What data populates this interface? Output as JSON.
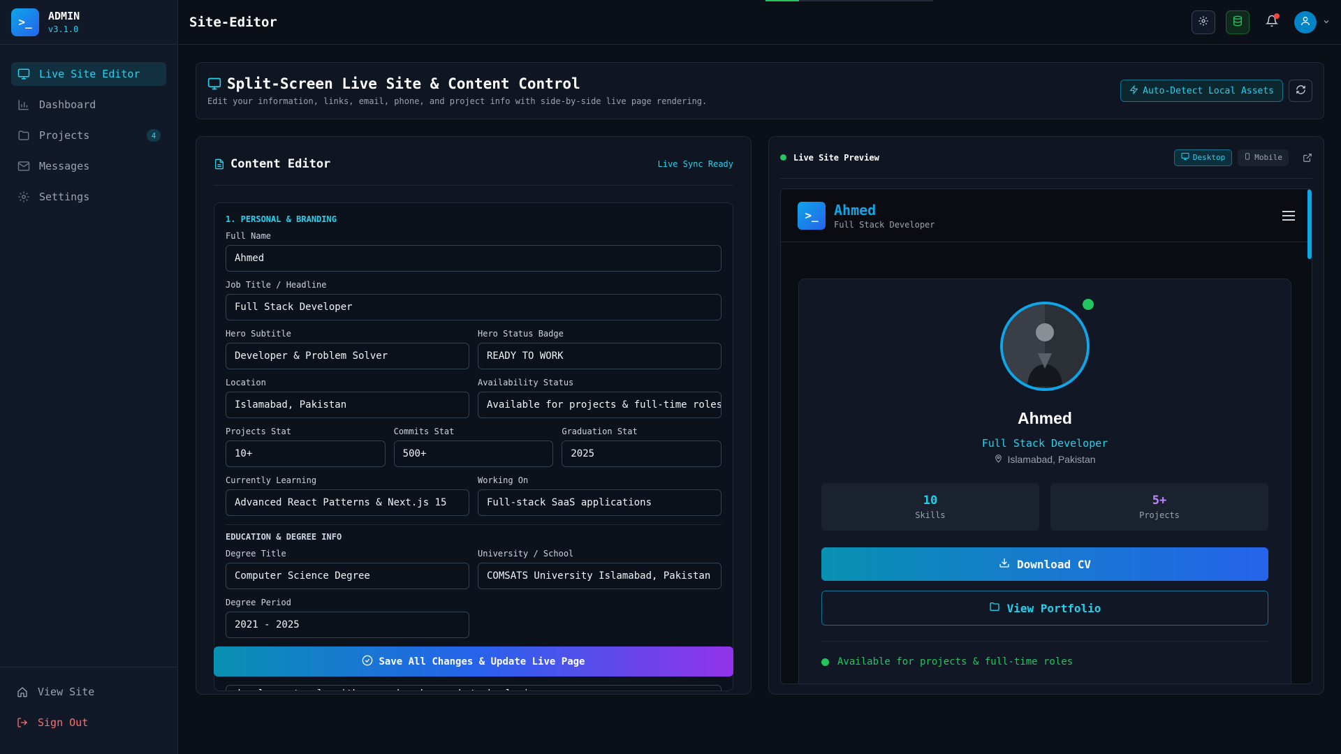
{
  "brand": {
    "name": "ADMIN",
    "version": "v3.1.0",
    "logo_glyph": ">_"
  },
  "sidebar": {
    "items": [
      {
        "label": "Live Site Editor",
        "icon": "monitor-icon",
        "active": true
      },
      {
        "label": "Dashboard",
        "icon": "bar-chart-icon"
      },
      {
        "label": "Projects",
        "icon": "folder-icon",
        "badge": "4"
      },
      {
        "label": "Messages",
        "icon": "mail-icon"
      },
      {
        "label": "Settings",
        "icon": "gear-icon"
      }
    ],
    "footer": [
      {
        "label": "View Site",
        "icon": "home-icon"
      },
      {
        "label": "Sign Out",
        "icon": "logout-icon"
      }
    ]
  },
  "topbar": {
    "title": "Site-Editor",
    "progress": 0.2
  },
  "header": {
    "title": "Split-Screen Live Site & Content Control",
    "subtitle": "Edit your information, links, email, phone, and project info with side-by-side live page rendering.",
    "auto_detect_label": "Auto-Detect Local Assets"
  },
  "editor": {
    "title": "Content Editor",
    "sync_status": "Live Sync Ready",
    "section_title": "1. PERSONAL & BRANDING",
    "fields": {
      "full_name": {
        "label": "Full Name",
        "value": "Ahmed"
      },
      "job_title": {
        "label": "Job Title / Headline",
        "value": "Full Stack Developer"
      },
      "hero_subtitle": {
        "label": "Hero Subtitle",
        "value": "Developer & Problem Solver"
      },
      "hero_status": {
        "label": "Hero Status Badge",
        "value": "READY TO WORK"
      },
      "location": {
        "label": "Location",
        "value": "Islamabad, Pakistan"
      },
      "availability": {
        "label": "Availability Status",
        "value": "Available for projects & full-time roles"
      },
      "projects_stat": {
        "label": "Projects Stat",
        "value": "10+"
      },
      "commits_stat": {
        "label": "Commits Stat",
        "value": "500+"
      },
      "graduation_stat": {
        "label": "Graduation Stat",
        "value": "2025"
      },
      "learning": {
        "label": "Currently Learning",
        "value": "Advanced React Patterns & Next.js 15"
      },
      "working_on": {
        "label": "Working On",
        "value": "Full-stack SaaS applications"
      },
      "degree_title": {
        "label": "Degree Title",
        "value": "Computer Science Degree"
      },
      "university": {
        "label": "University / School",
        "value": "COMSATS University Islamabad, Pakistan"
      },
      "degree_period": {
        "label": "Degree Period",
        "value": "2021 - 2025"
      }
    },
    "education_heading": "EDUCATION & DEGREE INFO",
    "bio_peek": "development, algorithms, and modern web technologies.",
    "save_label": "Save All Changes & Update Live Page"
  },
  "preview": {
    "title": "Live Site Preview",
    "desktop_label": "Desktop",
    "mobile_label": "Mobile",
    "site": {
      "name": "Ahmed",
      "tagline": "Full Stack Developer",
      "hero_name": "Ahmed",
      "hero_role": "Full Stack Developer",
      "hero_location": "Islamabad, Pakistan",
      "stats": [
        {
          "value": "10",
          "label": "Skills",
          "color": "#22d3ee"
        },
        {
          "value": "5+",
          "label": "Projects",
          "color": "#c084fc"
        }
      ],
      "cv_label": "Download CV",
      "portfolio_label": "View Portfolio",
      "availability": "Available for projects & full-time roles"
    }
  }
}
